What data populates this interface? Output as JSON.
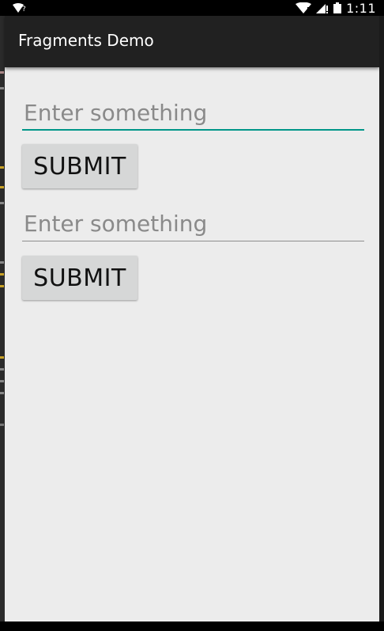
{
  "status_bar": {
    "time": "1:11",
    "unknown_glyph": "?",
    "icons": [
      "signal-icon",
      "wifi-icon",
      "battery-icon"
    ]
  },
  "action_bar": {
    "title": "Fragments Demo"
  },
  "fragments": [
    {
      "input_value": "",
      "input_placeholder": "Enter something",
      "input_focused": true,
      "button_label": "SUBMIT"
    },
    {
      "input_value": "",
      "input_placeholder": "Enter something",
      "input_focused": false,
      "button_label": "SUBMIT"
    }
  ],
  "colors": {
    "action_bar_bg": "#212121",
    "content_bg": "#ececec",
    "accent": "#009688",
    "button_bg": "#d6d7d7"
  }
}
